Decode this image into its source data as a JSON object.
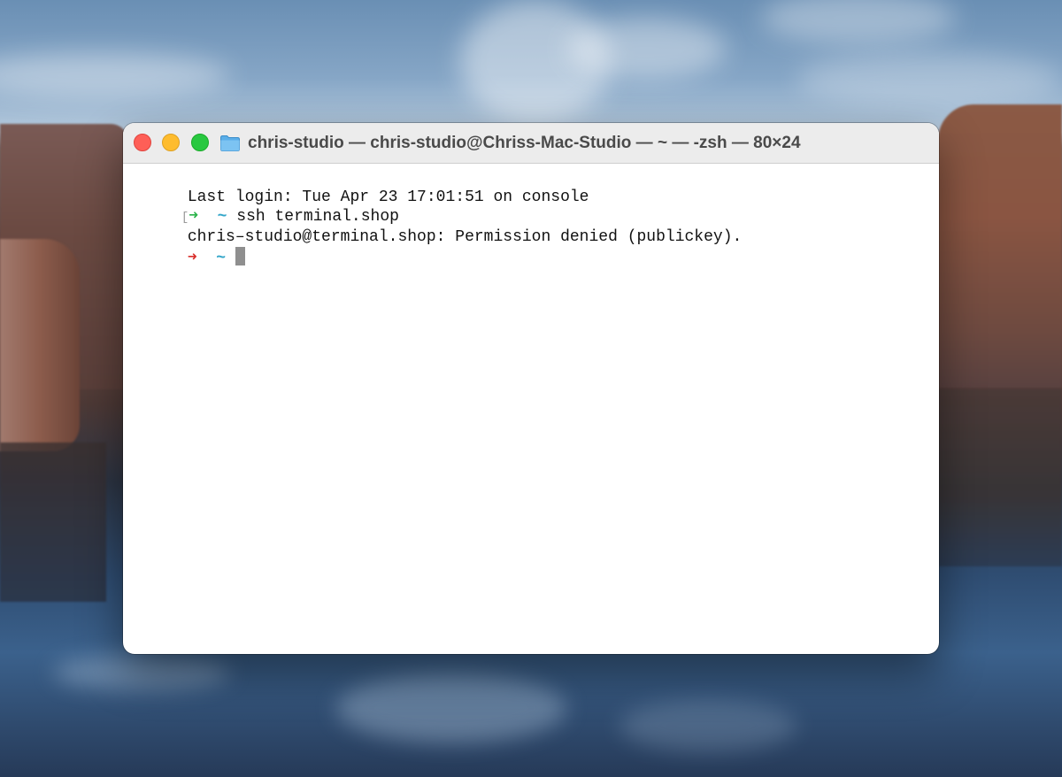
{
  "window": {
    "title": "chris-studio — chris-studio@Chriss-Mac-Studio — ~ — -zsh — 80×24",
    "folder_icon": "folder-icon",
    "traffic_lights": {
      "close": "#fe5f57",
      "minimize": "#febc2e",
      "zoom": "#28c840"
    }
  },
  "terminal": {
    "lines": [
      {
        "text": "Last login: Tue Apr 23 17:01:51 on console"
      },
      {
        "prompt_arrow": "➜",
        "prompt_path": "~",
        "command": "ssh terminal.shop",
        "status": "success"
      },
      {
        "text": "chris–studio@terminal.shop: Permission denied (publickey)."
      },
      {
        "prompt_arrow": "➜",
        "prompt_path": "~",
        "command": "",
        "status": "error",
        "has_cursor": true
      }
    ],
    "colors": {
      "arrow_success": "#2bb34a",
      "arrow_error": "#d9302c",
      "path": "#33a6c9"
    }
  }
}
